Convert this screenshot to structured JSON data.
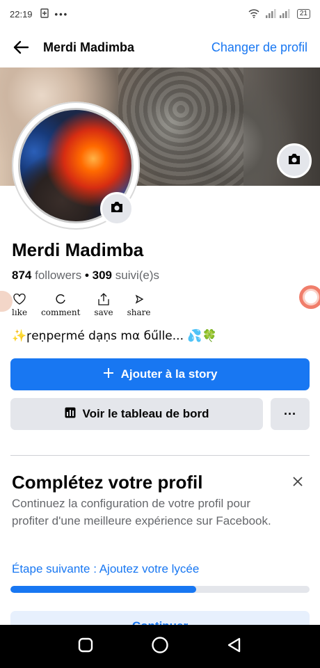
{
  "status_bar": {
    "time": "22:19",
    "battery": "21"
  },
  "header": {
    "title": "Merdi Madimba",
    "action": "Changer de profil"
  },
  "profile": {
    "name": "Merdi Madimba",
    "followers_count": "874",
    "followers_label": "followers",
    "separator": "•",
    "following_count": "309",
    "following_label": "suivi(e)s",
    "bio": "✨ꞅeṇpeꞅmé dạṇs mα бűlle... 💦🍀"
  },
  "reactions": [
    {
      "label": "lıke",
      "icon": "heart-icon"
    },
    {
      "label": "comment",
      "icon": "comment-icon"
    },
    {
      "label": "save",
      "icon": "save-icon"
    },
    {
      "label": "share",
      "icon": "share-icon"
    }
  ],
  "buttons": {
    "add_story": "Ajouter à la story",
    "dashboard": "Voir le tableau de bord",
    "more": "···"
  },
  "complete_profile": {
    "title": "Complétez votre profil",
    "description": "Continuez la configuration de votre profil pour profiter d'une meilleure expérience sur Facebook.",
    "next_step": "Étape suivante : Ajoutez votre lycée",
    "progress": 0.62,
    "continue": "Continuer"
  },
  "colors": {
    "accent": "#1877f2",
    "secondary_bg": "#e4e6eb"
  }
}
